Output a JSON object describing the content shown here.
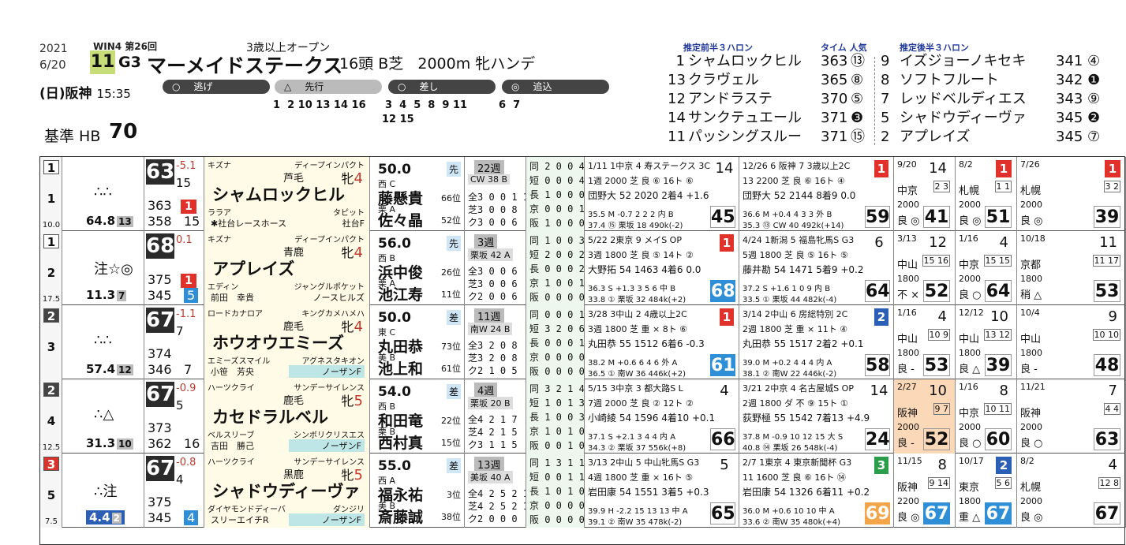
{
  "header": {
    "year": "2021",
    "date": "6/20",
    "win": "WIN4 第26回",
    "condition": "3歳以上オープン",
    "race_no": "11",
    "grade": "G3",
    "race_name": "マーメイドステークス",
    "race_info": "16頭 B芝   2000m 牝ハンデ",
    "day": "(日)阪神",
    "post_time": "15:35",
    "kijun_label": "基準 HB",
    "kijun_value": "70"
  },
  "styles": {
    "nige": {
      "label": "逃げ",
      "nums": "1  2 10 13 14 16"
    },
    "senko": {
      "label": "先行",
      "nums": "3  4  5  8  9 11"
    },
    "senko2": "12 15",
    "sashi": {
      "label": "差し",
      "nums": "6  7"
    },
    "oikomi": {
      "label": "追込",
      "nums": ""
    }
  },
  "pace": {
    "front_title": "推定前半３ハロン",
    "time_label": "タイム 人気",
    "back_title": "推定後半３ハロン",
    "front": [
      {
        "no": "1",
        "name": "シャムロックヒル",
        "time": "363",
        "pop": "⑬"
      },
      {
        "no": "13",
        "name": "クラヴェル",
        "time": "365",
        "pop": "⑧"
      },
      {
        "no": "12",
        "name": "アンドラステ",
        "time": "370",
        "pop": "⑤"
      },
      {
        "no": "14",
        "name": "サンクテュエール",
        "time": "371",
        "pop": "❸"
      },
      {
        "no": "11",
        "name": "パッシングスルー",
        "time": "371",
        "pop": "⑮"
      }
    ],
    "back": [
      {
        "no": "9",
        "name": "イズジョーノキセキ",
        "time": "341",
        "pop": "④"
      },
      {
        "no": "8",
        "name": "ソフトフルート",
        "time": "342",
        "pop": "❶"
      },
      {
        "no": "7",
        "name": "レッドベルディエス",
        "time": "343",
        "pop": "⑨"
      },
      {
        "no": "5",
        "name": "シャドウディーヴァ",
        "time": "345",
        "pop": "❷"
      },
      {
        "no": "2",
        "name": "アプレイズ",
        "time": "345",
        "pop": "⑦"
      }
    ]
  },
  "colors": {
    "red": "#e0322a",
    "blue": "#2a5fb5",
    "index_bg": "#2e8fd6",
    "gate_gray": "#555"
  },
  "horses": [
    {
      "waku": "1",
      "umaban": "1",
      "odds_side": "10.0",
      "marks": "∴∴",
      "odds": "64.8",
      "pop": "13",
      "idx": "63",
      "dev": "-5.1",
      "s1": "15",
      "n1": "363",
      "b1": "1",
      "n2": "358",
      "s2": "15",
      "sire": "キズナ",
      "bms_top": "ディープインパクト",
      "coat": "芦毛",
      "sex": "牝",
      "age": "4",
      "name": "シャムロックヒル",
      "dam": "ララア",
      "bms": "タピット",
      "owner": "✱社台レースホース",
      "breeder": "社台F",
      "weight": "50.0",
      "style": "先",
      "trainer": "西 C",
      "j1": "藤懸貴",
      "r1": "66位",
      "tr2": "栗 A",
      "j2": "佐々晶",
      "r2": "52位",
      "weeks": "22週",
      "course": "CW 38 B",
      "rec1": "全3 0 0 1 1",
      "rec2": "芝3 0 0 8",
      "rec3": "ク3 0 0 6",
      "sr": [
        "同 2 0 0 4",
        "短 0 0 0 4",
        "長 1 0 0 0",
        "京 0 0 0 1",
        "阪 1 0 0 0"
      ],
      "p1": {
        "t1": "1/11 1中京 4 寿ステークス 3C",
        "t2": "1週 2000 芝 良 ⑥ 16ト ⑥",
        "t3": "団野大 52 2020  2着4  +1.6",
        "t4": "35.5 M -0.7 2 2 2 内 B",
        "t5": "37.4 ⑮ 栗坂 18 490k(-2)",
        "idx": "45",
        "pos": "14",
        "posc": ""
      },
      "p2": {
        "t1": "12/26 6 阪神 7 3歳以上2C",
        "t2": "13 2200 芝 良 ⑥ 16ト ④",
        "t3": "団野大 52 2144  8着9  0.0",
        "t4": "36.6 M +0.4 4 3 3 外 B",
        "t5": "35.3 ⑬ CW 40 492k(+14)",
        "idx": "59",
        "pos": "1",
        "posc": "#e0322a"
      },
      "s1x": {
        "d": "9/20",
        "p": "14",
        "pb": "",
        "v": "中京",
        "g": "2 3",
        "ds": "2000",
        "c": "良 ◎",
        "ix": "41",
        "blue": false
      },
      "s2x": {
        "d": "8/2",
        "p": "",
        "pb": "1",
        "v": "札幌",
        "g": "1 1",
        "ds": "2000",
        "c": "良 ◎",
        "ix": "51",
        "blue": false
      },
      "s3x": {
        "d": "7/26",
        "p": "",
        "pb": "1",
        "v": "札幌",
        "g": "3 2",
        "ds": "2000",
        "c": "良 ◎",
        "ix": "39",
        "blue": false
      }
    },
    {
      "waku": "1",
      "umaban": "2",
      "odds_side": "17.5",
      "marks": "注☆◎",
      "odds": "11.3",
      "pop": "7",
      "idx": "68",
      "dev": "0.1",
      "s1": "",
      "n1": "375",
      "b1": "1",
      "n2": "345",
      "s2": "5",
      "sire": "キズナ",
      "bms_top": "ディープインパクト",
      "coat": "青鹿",
      "sex": "牝",
      "age": "4",
      "name": "アプレイズ",
      "dam": "エディン",
      "bms": "ジャングルポケット",
      "owner": "前田　幸貴",
      "breeder": "ノースヒルズ",
      "weight": "56.0",
      "style": "先",
      "trainer": "西 B",
      "j1": "浜中俊",
      "r1": "26位",
      "tr2": "栗 A",
      "j2": "池江寿",
      "r2": "11位",
      "weeks": "3週",
      "course": "栗坂 42 A",
      "rec1": "全3 0 0 6",
      "rec2": "芝3 0 0 6",
      "rec3": "ク2 0 0 6",
      "sr": [
        "同 1 0 0 3",
        "短 2 0 0 2",
        "長 0 0 0 2",
        "京 1 0 0 1",
        "阪 0 0 0 0"
      ],
      "p1": {
        "t1": "5/22 2東京 9 メイS OP",
        "t2": "3週 1800 芝 良 ⑤ 14ト ②",
        "t3": "大野拓 54 1463  4着6  0.0",
        "t4": "36.3 S +1.3 3 5 6 中 B",
        "t5": "33.8 ① 栗坂 32 484k(+2)",
        "idx": "68",
        "pos": "1",
        "posc": "#e0322a"
      },
      "p2": {
        "t1": "4/24 1新潟 5 福島牝馬S G3",
        "t2": "5週 1800 芝 良 ⑤ 16ト ⑤",
        "t3": "藤井勘 54 1471  5着9  +0.2",
        "t4": "37.2 S +1.6 1 0 9 内 B",
        "t5": "33.5 ① 栗坂 44 482k(-4)",
        "idx": "64",
        "pos": "6",
        "posc": ""
      },
      "s1x": {
        "d": "3/13",
        "p": "12",
        "pb": "",
        "v": "中山",
        "g": "15 16",
        "ds": "1800",
        "c": "不 ×",
        "ix": "52",
        "blue": false
      },
      "s2x": {
        "d": "1/16",
        "p": "4",
        "pb": "",
        "v": "中京",
        "g": "15 15",
        "ds": "2000",
        "c": "良 ○",
        "ix": "64",
        "blue": false
      },
      "s3x": {
        "d": "10/18",
        "p": "11",
        "pb": "",
        "v": "京都",
        "g": "11 17",
        "ds": "1800",
        "c": "稍 △",
        "ix": "53",
        "blue": false
      }
    },
    {
      "waku": "2",
      "umaban": "3",
      "odds_side": "",
      "marks": "∴∴",
      "odds": "57.4",
      "pop": "12",
      "idx": "67",
      "dev": "-1.1",
      "s1": "7",
      "n1": "374",
      "b1": "",
      "n2": "346",
      "s2": "7",
      "sire": "ロードカナロア",
      "bms_top": "キングカメハメハ",
      "coat": "鹿毛",
      "sex": "牝",
      "age": "4",
      "name": "ホウオウエミーズ",
      "dam": "エミーズスマイル",
      "bms": "アグネスタキオン",
      "owner": "小笹　芳央",
      "breeder": "ノーザンF",
      "weight": "50.0",
      "style": "差",
      "trainer": "東 C",
      "j1": "丸田恭",
      "r1": "73位",
      "tr2": "美 B",
      "j2": "池上和",
      "r2": "61位",
      "weeks": "11週",
      "course": "南W 24 B",
      "rec1": "全3 2 0 8",
      "rec2": "芝3 2 0 8",
      "rec3": "ク2 1 0 5",
      "sr": [
        "同 0 0 0 1",
        "短 3 2 0 6",
        "長 0 0 0 1",
        "京 0 0 0 0",
        "阪 0 0 0 0"
      ],
      "p1": {
        "t1": "3/28 3中山 2 4歳以上2C",
        "t2": "3週 1800 芝 重 × 8ト ⑥",
        "t3": "丸田恭 55 1512  6着6  -0.3",
        "t4": "38.2 M +0.6 6 4 6 外 A",
        "t5": "36.5 ① 南W 36 446k(+2)",
        "idx": "61",
        "pos": "1",
        "posc": "#e0322a"
      },
      "p2": {
        "t1": "3/14 2中山 6 房総特別 2C",
        "t2": "2週 1800 芝 重 × 11ト ④",
        "t3": "丸田恭 55 1517  2着2  +0.1",
        "t4": "39.0 M +0.2 4 4 4 内 A",
        "t5": "38.1 ② 南W 22 446k(-2)",
        "idx": "58",
        "pos": "2",
        "posc": "#2a5fb5"
      },
      "s1x": {
        "d": "1/16",
        "p": "4",
        "pb": "",
        "v": "中山",
        "g": "10 9",
        "ds": "1800",
        "c": "良 -",
        "ix": "53",
        "blue": false
      },
      "s2x": {
        "d": "12/12",
        "p": "10",
        "pb": "",
        "v": "中山",
        "g": "13 12",
        "ds": "1800",
        "c": "良 △",
        "ix": "39",
        "blue": false
      },
      "s3x": {
        "d": "10/4",
        "p": "9",
        "pb": "",
        "v": "中山",
        "g": "10 10",
        "ds": "1800",
        "c": "良 -",
        "ix": "48",
        "blue": false
      }
    },
    {
      "waku": "2",
      "umaban": "4",
      "odds_side": "12.5",
      "marks": "∴△",
      "odds": "31.3",
      "pop": "10",
      "idx": "67",
      "dev": "-0.9",
      "s1": "5",
      "n1": "373",
      "b1": "",
      "n2": "362",
      "s2": "16",
      "sire": "ハーツクライ",
      "bms_top": "サンデーサイレンス",
      "coat": "鹿毛",
      "sex": "牝",
      "age": "5",
      "name": "カセドラルベル",
      "dam": "ベルスリーブ",
      "bms": "シンボリクリスエス",
      "owner": "吉田　勝己",
      "breeder": "ノーザンF",
      "weight": "54.0",
      "style": "差",
      "trainer": "西 B",
      "j1": "和田竜",
      "r1": "22位",
      "tr2": "栗 B",
      "j2": "西村真",
      "r2": "15位",
      "weeks": "4週",
      "course": "栗坂 20 B",
      "rec1": "全4 2 1 7",
      "rec2": "芝4 2 1 5",
      "rec3": "ク3 1 1 5",
      "sr": [
        "同 3 2 1 4",
        "短 1 0 1 3",
        "長 1 0 0 3",
        "京 1 0 1 0",
        "阪 0 0 1 0"
      ],
      "p1": {
        "t1": "5/15 3中京 3 都大路S L",
        "t2": "7週 2000 芝 良 ② 12ト ②",
        "t3": "小崎綾 54 1596  4着10  +0.1",
        "t4": "37.1 S +2.1 3 4 4 内 A",
        "t5": "34.3 ② 栗坂 37 556k(+8)",
        "idx": "66",
        "pos": "4",
        "posc": ""
      },
      "p2": {
        "t1": "3/21 2中京 4 名古屋城S OP",
        "t2": "2週 1800 ダ 不 ⑨ 15ト ①",
        "t3": "荻野極 55 1542  7着13  +4.9",
        "t4": "37.8 M -0.9 10 12 15 大 S",
        "t5": "40.8 ⑭ 栗坂 26 548k(-4)",
        "idx": "24",
        "pos": "14",
        "posc": ""
      },
      "s1x": {
        "d": "2/27",
        "p": "10",
        "pb": "",
        "v": "阪神",
        "g": "9 7",
        "ds": "2000",
        "c": "良 -",
        "ix": "52",
        "blue": false,
        "hl": true
      },
      "s2x": {
        "d": "1/16",
        "p": "8",
        "pb": "",
        "v": "中京",
        "g": "10 11",
        "ds": "2000",
        "c": "良 ○",
        "ix": "60",
        "blue": false
      },
      "s3x": {
        "d": "11/21",
        "p": "7",
        "pb": "",
        "v": "阪神",
        "g": "4 4",
        "ds": "2000",
        "c": "良 ○",
        "ix": "63",
        "blue": false
      }
    },
    {
      "waku": "3",
      "umaban": "5",
      "odds_side": "7.5",
      "marks": "∴注",
      "odds": "4.4",
      "pop": "2",
      "idx": "67",
      "dev": "-0.8",
      "s1": "4",
      "n1": "375",
      "b1": "",
      "n2": "345",
      "s2": "4",
      "sire": "ハーツクライ",
      "bms_top": "サンデーサイレンス",
      "coat": "黒鹿",
      "sex": "牝",
      "age": "5",
      "name": "シャドウディーヴァ",
      "dam": "ダイヤモンドディーバ",
      "bms": "ダンジリ",
      "owner": "スリーエイチR",
      "breeder": "ノーザンF",
      "weight": "55.0",
      "style": "差",
      "trainer": "西 A",
      "j1": "福永祐",
      "r1": "3位",
      "tr2": "美 B",
      "j2": "斎藤誠",
      "r2": "38位",
      "weeks": "13週",
      "course": "美坂 40 A",
      "rec1": "全4 2 5 2 1",
      "rec2": "芝4 2 5 2 1",
      "rec3": "ク2 0 0 0",
      "sr": [
        "同 1 3 1 1",
        "短 0 0 1 1",
        "長 1 0 1 0",
        "京 0 0 0 0",
        "阪 0 0 0 0"
      ],
      "p1": {
        "t1": "3/13 2中山 5 中山牝馬S G3",
        "t2": "4週 1800 芝 重 × 16ト ⑤",
        "t3": "岩田康 54 1551  3着5  +0.3",
        "t4": "39.9 H -2.2 15 13 13 中 A",
        "t5": "39.1 ② 南W 35 478k(-2)",
        "idx": "65",
        "pos": "5",
        "posc": ""
      },
      "p2": {
        "t1": "2/7 1東京 4 東京新聞杯 G3",
        "t2": "11 1600 芝 良 ⑥ 16ト ⑭",
        "t3": "岩田康 54 1326  6着11  +0.2",
        "t4": "36.0 M +0.6 10 10 中 A",
        "t5": "33.6 ② 南W 35 480k(+4)",
        "idx": "69",
        "pos": "3",
        "posc": "#2a9d4a"
      },
      "s1x": {
        "d": "11/15",
        "p": "8",
        "pb": "",
        "v": "阪神",
        "g": "9 14",
        "ds": "2200",
        "c": "良 ◎",
        "ix": "67",
        "blue": true
      },
      "s2x": {
        "d": "10/17",
        "p": "",
        "pb": "2",
        "v": "東京",
        "g": "5 6",
        "ds": "1800",
        "c": "重 △",
        "ix": "67",
        "blue": true
      },
      "s3x": {
        "d": "8/2",
        "p": "4",
        "pb": "",
        "v": "札幌",
        "g": "12 8",
        "ds": "2000",
        "c": "良 ◎",
        "ix": "67",
        "blue": false
      }
    }
  ]
}
